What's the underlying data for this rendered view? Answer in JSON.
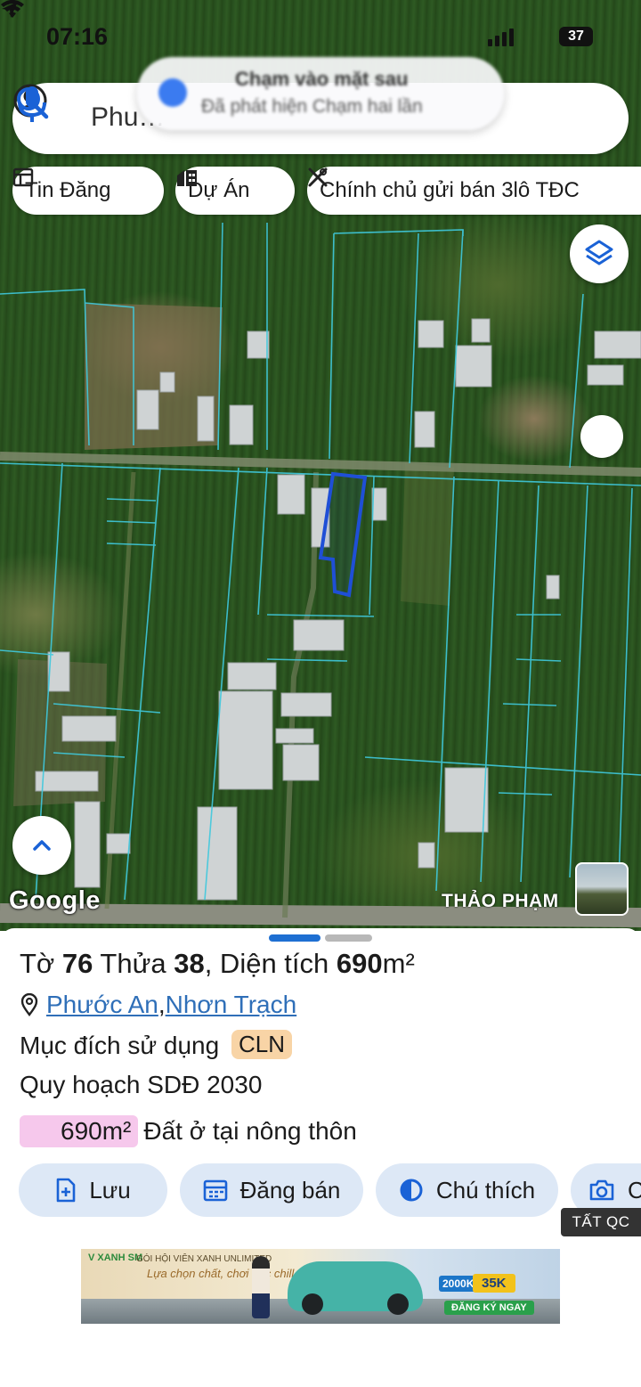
{
  "status_bar": {
    "time": "07:16",
    "battery": "37",
    "location_icon": "location-arrow-icon",
    "wifi_icon": "wifi-icon"
  },
  "search": {
    "query": "Phu…",
    "account_icon": "account-icon",
    "search_icon": "search-icon",
    "mic_icon": "mic-icon"
  },
  "toast": {
    "title": "Chạm vào mặt sau",
    "subtitle": "Đã phát hiện Chạm hai lần"
  },
  "chips": [
    {
      "label": "Tin Đăng",
      "icon": "listing-icon"
    },
    {
      "label": "Dự Án",
      "icon": "building-icon"
    },
    {
      "label": "Chính chủ gửi bán 3lô TĐC",
      "icon": "tools-icon"
    }
  ],
  "map": {
    "attribution": "Google",
    "credit": "THẢO PHẠM",
    "layers_icon": "layers-icon",
    "expand_icon": "chevron-up-icon",
    "parcel_color": "#1f4fd6",
    "boundary_color": "#3fc9dd"
  },
  "sheet": {
    "title": {
      "p1": "Tờ ",
      "sheet_no": "76",
      "p2": " Thửa ",
      "plot_no": "38",
      "p3": ", Diện tích ",
      "area": "690",
      "unit": "m²"
    },
    "place": {
      "ward": "Phước An",
      "sep": ", ",
      "district": "Nhơn Trạch",
      "icon": "map-pin-icon"
    },
    "usage_label": "Mục đích sử dụng",
    "usage_code": "CLN",
    "plan_label": "Quy hoạch SDĐ 2030",
    "plan_area": "690m²",
    "plan_type": "Đất ở tại nông thôn",
    "plan_color": "#f6c8ec",
    "usage_color": "#f8d4a6"
  },
  "actions": [
    {
      "label": "Lưu",
      "icon": "save-file-icon"
    },
    {
      "label": "Đăng bán",
      "icon": "calendar-icon"
    },
    {
      "label": "Chú thích",
      "icon": "contrast-icon"
    },
    {
      "label": "C",
      "icon": "camera-icon"
    }
  ],
  "ad": {
    "hide_label": "TẤT QC",
    "brand": "V XANH SM",
    "line1": "GÓI HỘI VIÊN XANH UNLIMITED",
    "line2": "Lựa chọn chất, chơi cực chill",
    "price1": "2000K",
    "price2": "35K",
    "cta": "ĐĂNG KÝ NGAY"
  }
}
